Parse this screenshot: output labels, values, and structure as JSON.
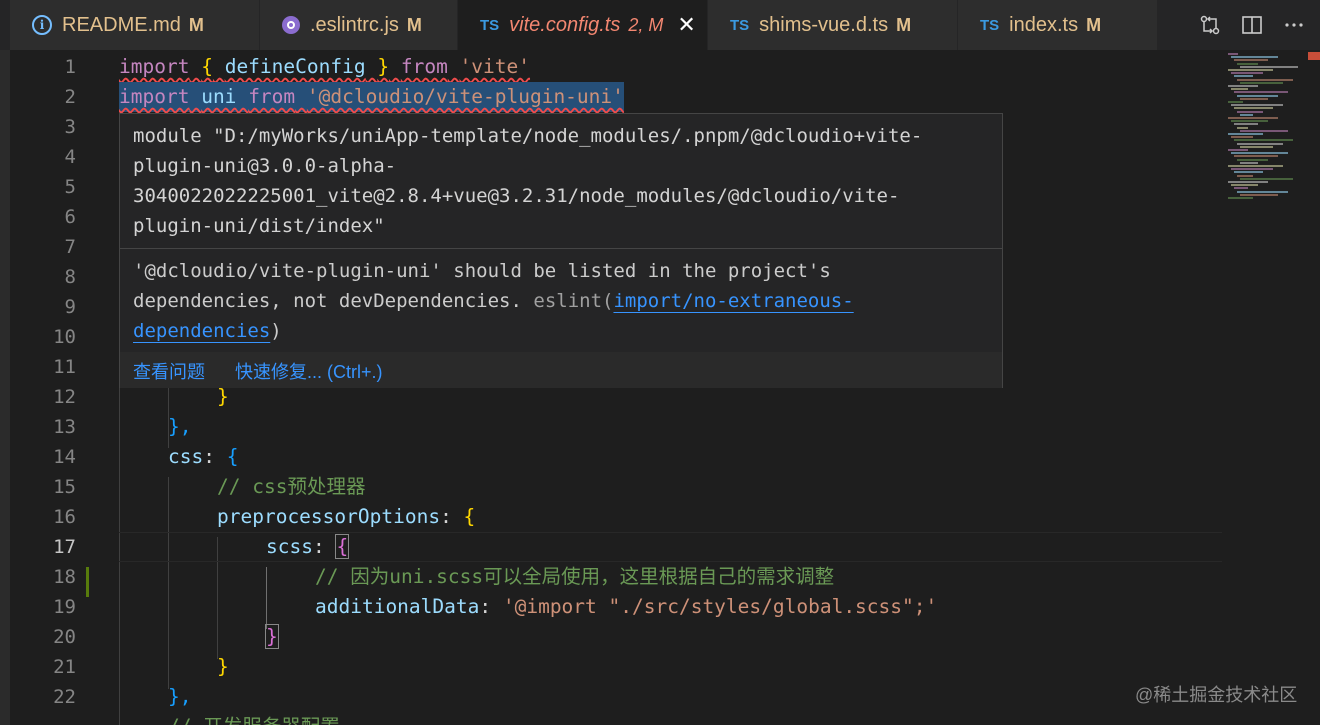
{
  "tabs": [
    {
      "icon": "info-icon",
      "label": "README.md",
      "mark": "M"
    },
    {
      "icon": "eslint-icon",
      "label": ".eslintrc.js",
      "mark": "M"
    },
    {
      "icon": "ts-icon",
      "icon_text": "TS",
      "label": "vite.config.ts",
      "mark": "2, M",
      "active": true
    },
    {
      "icon": "ts-icon",
      "icon_text": "TS",
      "label": "shims-vue.d.ts",
      "mark": "M"
    },
    {
      "icon": "ts-icon",
      "icon_text": "TS",
      "label": "index.ts",
      "mark": "M"
    }
  ],
  "tab_close_glyph": "✕",
  "editor_actions": [
    "compare-changes-icon",
    "split-editor-icon",
    "more-actions-icon"
  ],
  "line_numbers": [
    "1",
    "2",
    "3",
    "4",
    "5",
    "6",
    "7",
    "8",
    "9",
    "10",
    "11",
    "12",
    "13",
    "14",
    "15",
    "16",
    "17",
    "18",
    "19",
    "20",
    "21",
    "22"
  ],
  "active_line": "17",
  "code": {
    "l1": {
      "import": "import",
      "open": "{",
      "name": "defineConfig",
      "close": "}",
      "from": "from",
      "module": "'vite'"
    },
    "l2": {
      "import": "import",
      "name": "uni",
      "from": "from",
      "module": "'@dcloudio/vite-plugin-uni'"
    },
    "l12": {
      "brace": "}"
    },
    "l13": {
      "brace": "},"
    },
    "l14": {
      "key": "css",
      "colon": ": ",
      "brace": "{"
    },
    "l15": {
      "comment": "// css预处理器"
    },
    "l16": {
      "key": "preprocessorOptions",
      "colon": ": ",
      "brace": "{"
    },
    "l17": {
      "key": "scss",
      "colon": ": ",
      "brace": "{"
    },
    "l18": {
      "comment": "// 因为uni.scss可以全局使用，这里根据自己的需求调整"
    },
    "l19": {
      "key": "additionalData",
      "colon": ": ",
      "value": "'@import \"./src/styles/global.scss\";'"
    },
    "l20": {
      "brace": "}"
    },
    "l21": {
      "brace": "}"
    },
    "l22": {
      "brace": "},"
    },
    "l23_partial": {
      "comment": "// 开发服务器配置"
    }
  },
  "hover": {
    "module_lines": [
      "module \"D:/myWorks/uniApp-template/node_modules/.pnpm/@dcloudio+vite-",
      "plugin-uni@3.0.0-alpha-",
      "3040022022225001_vite@2.8.4+vue@3.2.31/node_modules/@dcloudio/vite-",
      "plugin-uni/dist/index\""
    ],
    "problem_line1": "'@dcloudio/vite-plugin-uni' should be listed in the project's",
    "problem_line2_prefix": "dependencies, not devDependencies.",
    "problem_source": "eslint(",
    "rule_part1": "import/no-extraneous-",
    "rule_part2": "dependencies",
    "problem_suffix": ")",
    "view_problem": "查看问题",
    "quick_fix": "快速修复... (Ctrl+.)"
  },
  "watermark": "@稀土掘金技术社区",
  "colors": {
    "background": "#1e1e1e",
    "tab_bar": "#252526",
    "link": "#3794ff",
    "error": "#f48771",
    "modified": "#e2c08d"
  }
}
